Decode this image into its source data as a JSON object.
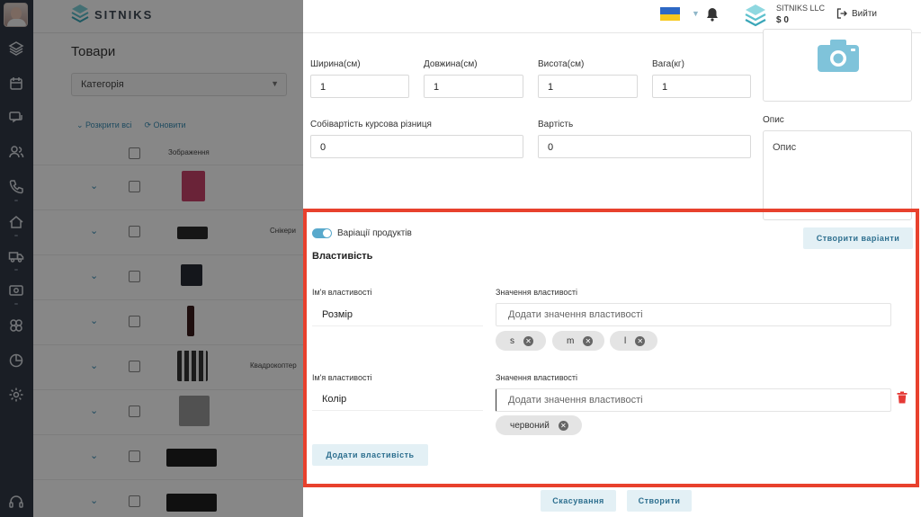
{
  "brand": {
    "name": "SITNIKS"
  },
  "header": {
    "company_name": "SITNIKS LLC",
    "balance": "$ 0",
    "logout_label": "Вийти"
  },
  "sidebar": {
    "icons": [
      "layers-icon",
      "calendar-icon",
      "chat-icon",
      "users-icon",
      "phone-icon",
      "home-icon",
      "truck-icon",
      "money-icon",
      "integrations-icon",
      "analytics-icon",
      "settings-icon",
      "support-headset-icon"
    ]
  },
  "background": {
    "page_title": "Товари",
    "category_placeholder": "Категорія",
    "expand_all": "Розкрити всі",
    "refresh": "Оновити",
    "image_column": "Зображення",
    "row_labels": {
      "sneakers": "Снікери",
      "quadcopter": "Квадрокоптер"
    }
  },
  "form": {
    "width_label": "Ширина(см)",
    "width_value": "1",
    "length_label": "Довжина(см)",
    "length_value": "1",
    "height_label": "Висота(см)",
    "height_value": "1",
    "weight_label": "Вага(кг)",
    "weight_value": "1",
    "cost_diff_label": "Собівартість курсова різниця",
    "cost_diff_value": "0",
    "cost_label": "Вартість",
    "cost_value": "0",
    "description_label": "Опис",
    "description_placeholder": "Опис"
  },
  "variations": {
    "toggle_label": "Варіації продуктів",
    "toggle_on": true,
    "create_variants_button": "Створити варіанти",
    "section_title": "Властивість",
    "properties": [
      {
        "name_label": "Ім'я властивості",
        "name": "Розмір",
        "values_label": "Значення властивості",
        "values_placeholder": "Додати значення властивості",
        "values": [
          "s",
          "m",
          "l"
        ]
      },
      {
        "name_label": "Ім'я властивості",
        "name": "Колір",
        "values_label": "Значення властивості",
        "values_placeholder": "Додати значення властивості",
        "values": [
          "червоний"
        ]
      }
    ],
    "add_property_button": "Додати властивість"
  },
  "footer": {
    "cancel_button": "Скасування",
    "create_button": "Створити"
  },
  "colors": {
    "accent": "#59a9cc",
    "highlight": "#e8412d",
    "sidebar": "#323a46",
    "delete": "#e53935"
  }
}
